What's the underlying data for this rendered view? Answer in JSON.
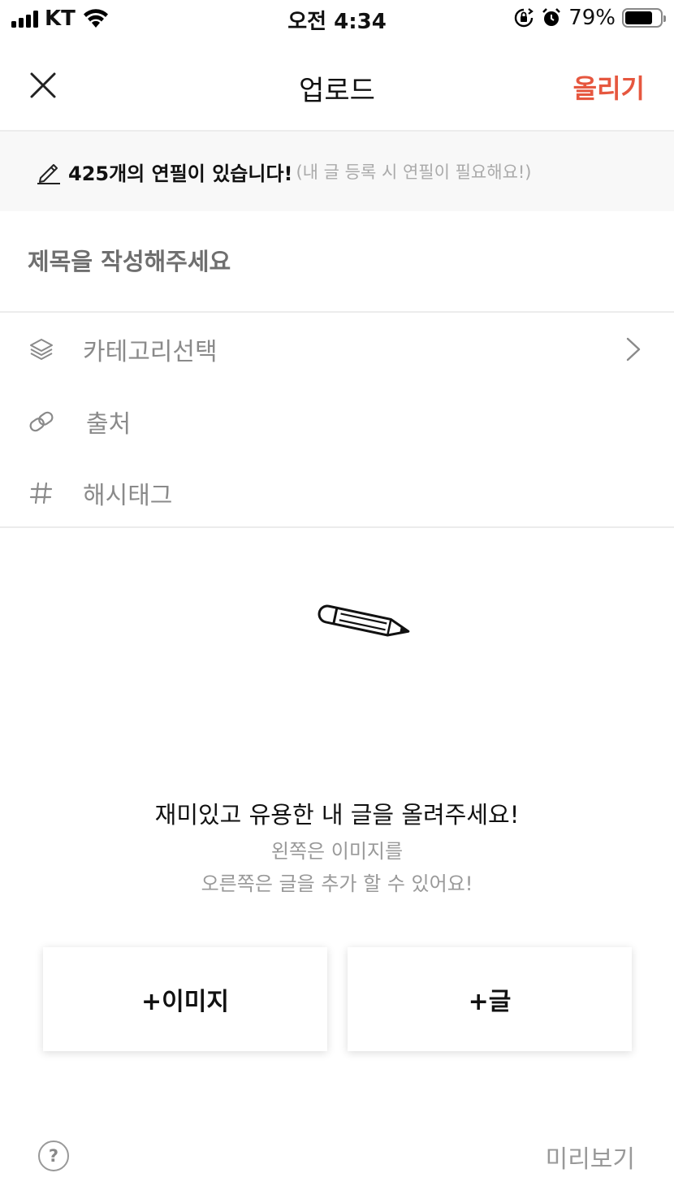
{
  "status_bar": {
    "carrier": "KT",
    "time": "오전 4:34",
    "battery_percent": "79%",
    "battery_level": 0.79,
    "icons": [
      "signal-icon",
      "wifi-icon",
      "rotation-lock-icon",
      "alarm-icon",
      "battery-icon"
    ]
  },
  "header": {
    "title": "업로드",
    "close_icon": "close-icon",
    "submit_label": "올리기"
  },
  "pencil_notice": {
    "icon": "pencil-icon",
    "main": "425개의 연필이 있습니다!",
    "sub": "(내 글 등록 시 연필이 필요해요!)"
  },
  "title_field": {
    "placeholder": "제목을 작성해주세요",
    "value": ""
  },
  "options": {
    "category": {
      "icon": "layers-icon",
      "label": "카테고리선택",
      "chevron": "chevron-right-icon"
    },
    "source": {
      "icon": "link-icon",
      "label": "출처"
    },
    "hashtag": {
      "icon": "hashtag-icon",
      "label": "해시태그"
    }
  },
  "empty_state": {
    "illustration": "pencil-illustration",
    "main": "재미있고 유용한 내 글을 올려주세요!",
    "sub_line1": "왼쪽은 이미지를",
    "sub_line2": "오른쪽은 글을 추가 할 수 있어요!"
  },
  "buttons": {
    "add_image": "+이미지",
    "add_text": "+글"
  },
  "footer": {
    "help_icon": "help-icon",
    "help_symbol": "?",
    "preview_label": "미리보기"
  },
  "colors": {
    "accent": "#e6573f",
    "muted_text": "#8a8a8a",
    "notice_bg": "#f8f8f8",
    "divider": "#ececec"
  }
}
